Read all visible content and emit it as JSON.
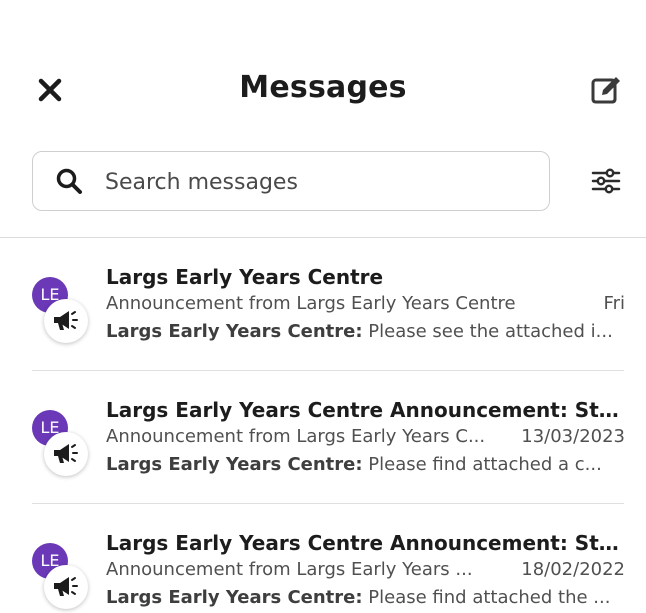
{
  "header": {
    "title": "Messages"
  },
  "search": {
    "placeholder": "Search messages"
  },
  "messages": [
    {
      "avatar_initials": "LE",
      "title": "Largs Early Years Centre",
      "subtitle": "Announcement from Largs Early Years Centre",
      "date": "Fri",
      "sender": "Largs Early Years Centre:",
      "preview": "Please see the attached i..."
    },
    {
      "avatar_initials": "LE",
      "title": "Largs Early Years Centre Announcement: Stud...",
      "subtitle": "Announcement from Largs Early Years C...",
      "date": "13/03/2023",
      "sender": "Largs Early Years Centre:",
      "preview": "Please find attached a c..."
    },
    {
      "avatar_initials": "LE",
      "title": "Largs Early Years Centre Announcement: Stud...",
      "subtitle": "Announcement from Largs Early Years ...",
      "date": "18/02/2022",
      "sender": "Largs Early Years Centre:",
      "preview": "Please find attached the ..."
    }
  ],
  "colors": {
    "avatar_bg": "#6b38b8",
    "text_dark": "#1c1c1c",
    "text_muted": "#505050"
  },
  "icons": [
    "close-icon",
    "compose-icon",
    "search-icon",
    "filter-icon",
    "megaphone-icon"
  ]
}
